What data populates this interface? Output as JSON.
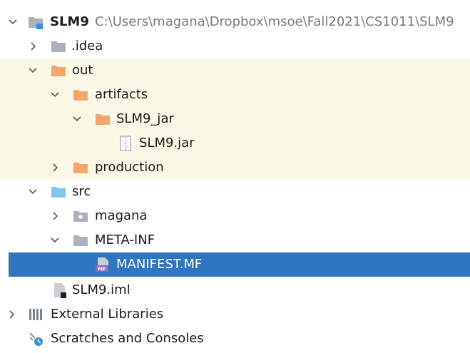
{
  "tree": {
    "project": {
      "name": "SLM9",
      "path": "C:\\Users\\magana\\Dropbox\\msoe\\Fall2021\\CS1011\\SLM9"
    },
    "idea": {
      "label": ".idea"
    },
    "out": {
      "label": "out"
    },
    "artifacts": {
      "label": "artifacts"
    },
    "slm9_jar_folder": {
      "label": "SLM9_jar"
    },
    "slm9_jar_file": {
      "label": "SLM9.jar"
    },
    "production": {
      "label": "production"
    },
    "src": {
      "label": "src"
    },
    "magana": {
      "label": "magana"
    },
    "meta_inf": {
      "label": "META-INF"
    },
    "manifest": {
      "label": "MANIFEST.MF",
      "icon_text": "MF"
    },
    "iml": {
      "label": "SLM9.iml"
    },
    "external_libraries": {
      "label": "External Libraries"
    },
    "scratches": {
      "label": "Scratches and Consoles"
    }
  },
  "colors": {
    "folder_gray": "#a9b2bc",
    "folder_orange": "#f6a56a",
    "folder_blue": "#7fc7e8",
    "excluded_bg": "#fbf9e5",
    "selection_bg": "#2f76c0"
  }
}
